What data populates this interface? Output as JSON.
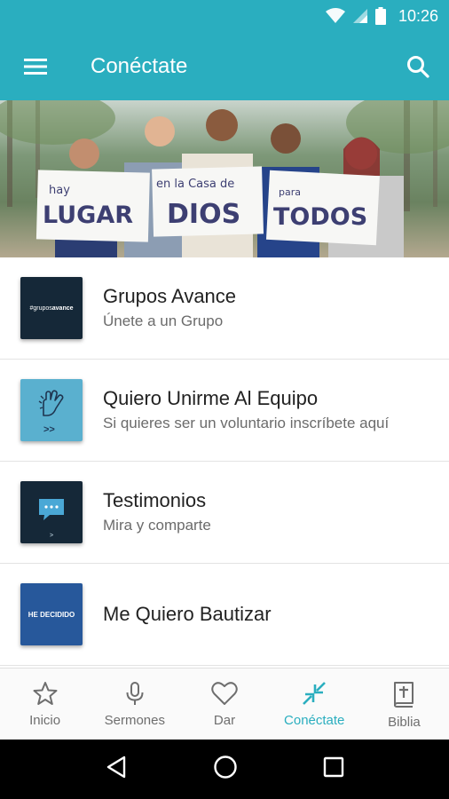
{
  "status_bar": {
    "time": "10:26",
    "icons": [
      "wifi-icon",
      "signal-icon",
      "battery-icon"
    ]
  },
  "app_bar": {
    "title": "Conéctate",
    "menu_icon": "hamburger-menu-icon",
    "search_icon": "search-icon"
  },
  "colors": {
    "accent": "#2aaebf",
    "primary_text": "#222222",
    "secondary_text": "#6b6b6b"
  },
  "hero": {
    "signs": [
      {
        "small": "hay",
        "large": "LUGAR"
      },
      {
        "small": "en la Casa de",
        "large": "DIOS"
      },
      {
        "small": "para",
        "large": "TODOS"
      }
    ]
  },
  "items": [
    {
      "title": "Grupos Avance",
      "subtitle": "Únete a un Grupo",
      "thumb_prefix": "#grupos",
      "thumb_bold": "avance"
    },
    {
      "title": "Quiero Unirme Al Equipo",
      "subtitle": "Si quieres ser un voluntario inscríbete aquí",
      "thumb_icon": "raised-hand-icon"
    },
    {
      "title": "Testimonios",
      "subtitle": "Mira y comparte",
      "thumb_icon": "chat-bubble-icon"
    },
    {
      "title": "Me Quiero Bautizar",
      "subtitle": "",
      "thumb_text": "HE DECIDIDO"
    }
  ],
  "bottom_nav": [
    {
      "label": "Inicio",
      "icon": "star-icon",
      "active": false
    },
    {
      "label": "Sermones",
      "icon": "microphone-icon",
      "active": false
    },
    {
      "label": "Dar",
      "icon": "heart-icon",
      "active": false
    },
    {
      "label": "Conéctate",
      "icon": "connect-arrows-icon",
      "active": true
    },
    {
      "label": "Biblia",
      "icon": "bible-icon",
      "active": false
    }
  ],
  "system_nav": [
    "back-icon",
    "home-icon",
    "recents-icon"
  ]
}
